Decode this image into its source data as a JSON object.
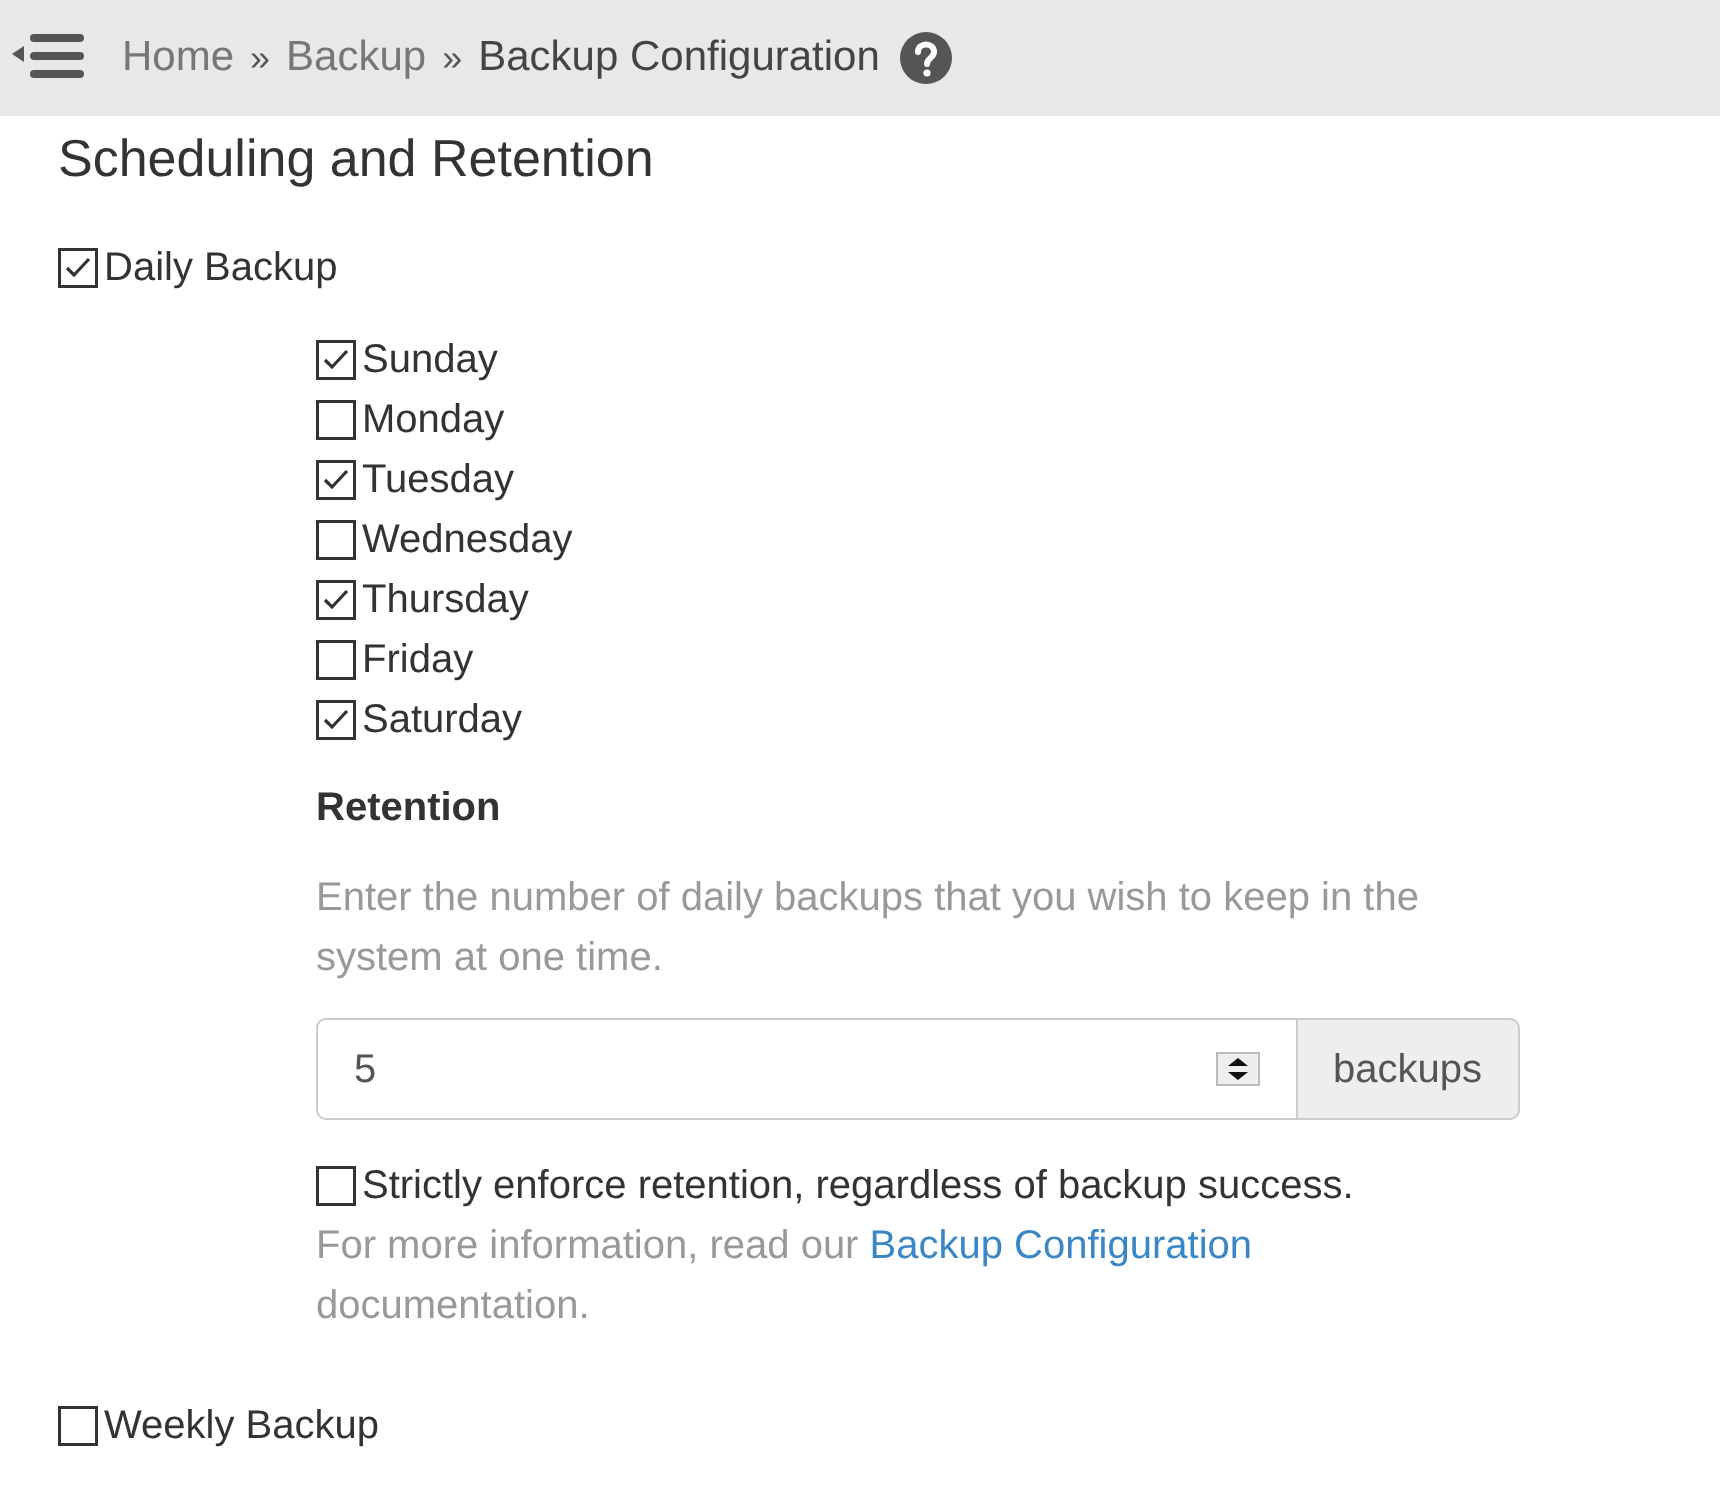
{
  "breadcrumb": [
    {
      "label": "Home",
      "kind": "link"
    },
    {
      "label": "»",
      "kind": "separator"
    },
    {
      "label": "Backup",
      "kind": "link"
    },
    {
      "label": "»",
      "kind": "separator"
    },
    {
      "label": "Backup Configuration",
      "kind": "current"
    }
  ],
  "section_title": "Scheduling and Retention",
  "daily_backup": {
    "label": "Daily Backup",
    "checked": true
  },
  "days": [
    {
      "label": "Sunday",
      "checked": true
    },
    {
      "label": "Monday",
      "checked": false
    },
    {
      "label": "Tuesday",
      "checked": true
    },
    {
      "label": "Wednesday",
      "checked": false
    },
    {
      "label": "Thursday",
      "checked": true
    },
    {
      "label": "Friday",
      "checked": false
    },
    {
      "label": "Saturday",
      "checked": true
    }
  ],
  "retention": {
    "heading": "Retention",
    "description": "Enter the number of daily backups that you wish to keep in the system at one time.",
    "value": "5",
    "unit": "backups"
  },
  "strict": {
    "label": "Strictly enforce retention, regardless of backup success.",
    "checked": false
  },
  "info": {
    "prefix": "For more information, read our",
    "link": "Backup Configuration",
    "suffix": "documentation."
  },
  "weekly_backup": {
    "label": "Weekly Backup",
    "checked": false
  }
}
